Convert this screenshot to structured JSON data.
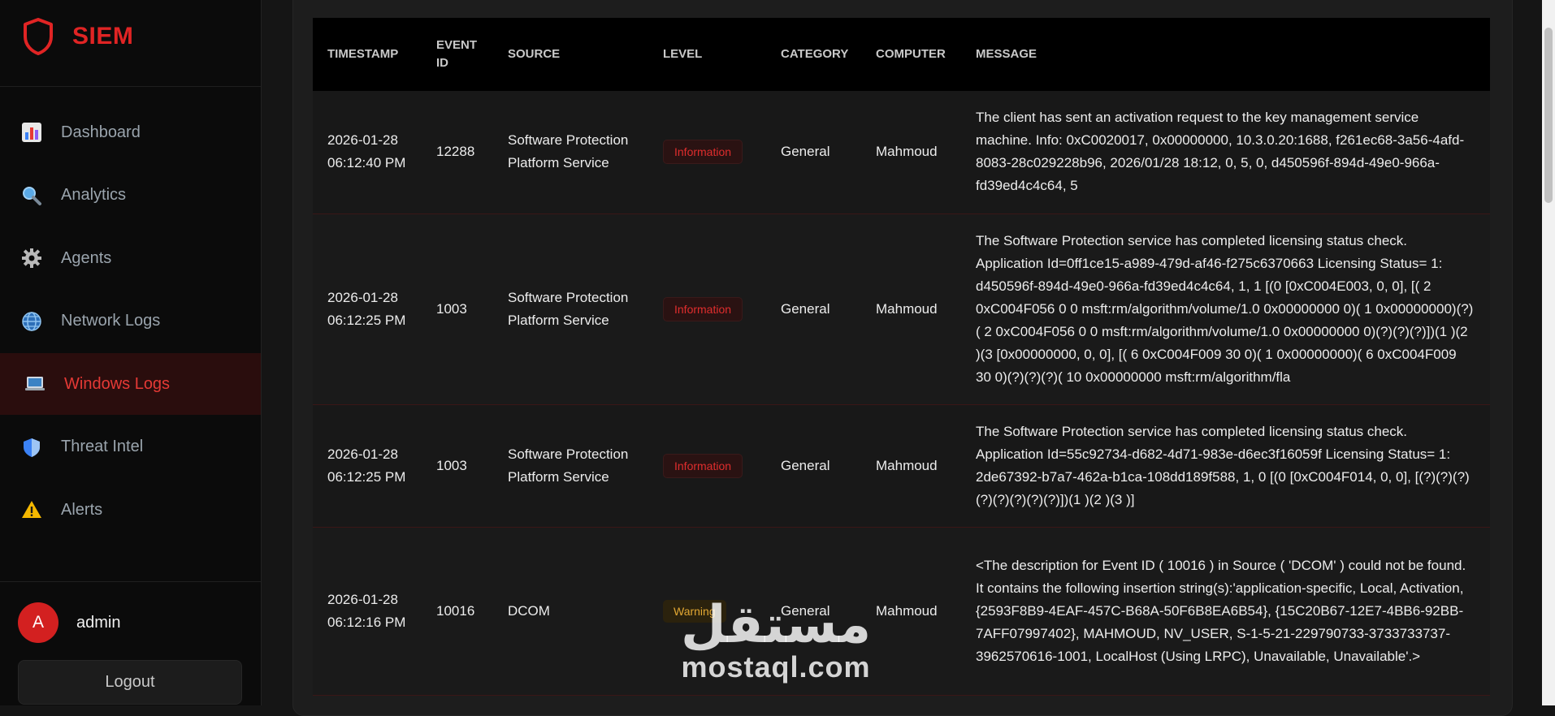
{
  "app": {
    "brand": "SIEM",
    "accent": "#e02424"
  },
  "sidebar": {
    "items": [
      {
        "label": "Dashboard",
        "icon": "bar-chart-icon"
      },
      {
        "label": "Analytics",
        "icon": "magnifier-icon"
      },
      {
        "label": "Agents",
        "icon": "gear-icon"
      },
      {
        "label": "Network Logs",
        "icon": "globe-icon"
      },
      {
        "label": "Windows Logs",
        "icon": "laptop-icon",
        "active": true
      },
      {
        "label": "Threat Intel",
        "icon": "shield-icon"
      },
      {
        "label": "Alerts",
        "icon": "warning-icon"
      }
    ],
    "user": {
      "initial": "A",
      "name": "admin"
    },
    "logout_label": "Logout"
  },
  "table": {
    "headers": [
      "TIMESTAMP",
      "EVENT ID",
      "SOURCE",
      "LEVEL",
      "CATEGORY",
      "COMPUTER",
      "MESSAGE"
    ],
    "rows": [
      {
        "timestamp": "2026-01-28 06:12:40 PM",
        "event_id": "12288",
        "source": "Software Protection Platform Service",
        "level": "Information",
        "category": "General",
        "computer": "Mahmoud",
        "message": "The client has sent an activation request to the key management service machine. Info: 0xC0020017, 0x00000000, 10.3.0.20:1688, f261ec68-3a56-4afd-8083-28c029228b96, 2026/01/28 18:12, 0, 5, 0, d450596f-894d-49e0-966a-fd39ed4c4c64, 5"
      },
      {
        "timestamp": "2026-01-28 06:12:25 PM",
        "event_id": "1003",
        "source": "Software Protection Platform Service",
        "level": "Information",
        "category": "General",
        "computer": "Mahmoud",
        "message": "The Software Protection service has completed licensing status check. Application Id=0ff1ce15-a989-479d-af46-f275c6370663 Licensing Status= 1: d450596f-894d-49e0-966a-fd39ed4c4c64, 1, 1 [(0 [0xC004E003, 0, 0], [( 2 0xC004F056 0 0 msft:rm/algorithm/volume/1.0 0x00000000 0)( 1 0x00000000)(?)( 2 0xC004F056 0 0 msft:rm/algorithm/volume/1.0 0x00000000 0)(?)(?)(?)])(1 )(2 )(3 [0x00000000, 0, 0], [( 6 0xC004F009 30 0)( 1 0x00000000)( 6 0xC004F009 30 0)(?)(?)(?)( 10 0x00000000 msft:rm/algorithm/fla"
      },
      {
        "timestamp": "2026-01-28 06:12:25 PM",
        "event_id": "1003",
        "source": "Software Protection Platform Service",
        "level": "Information",
        "category": "General",
        "computer": "Mahmoud",
        "message": "The Software Protection service has completed licensing status check. Application Id=55c92734-d682-4d71-983e-d6ec3f16059f Licensing Status= 1: 2de67392-b7a7-462a-b1ca-108dd189f588, 1, 0 [(0 [0xC004F014, 0, 0], [(?)(?)(?)(?)(?)(?)(?)(?)])(1 )(2 )(3 )]"
      },
      {
        "timestamp": "2026-01-28 06:12:16 PM",
        "event_id": "10016",
        "source": "DCOM",
        "level": "Warning",
        "category": "General",
        "computer": "Mahmoud",
        "message": "<The description for Event ID ( 10016 ) in Source ( 'DCOM' ) could not be found. It contains the following insertion string(s):'application-specific, Local, Activation, {2593F8B9-4EAF-457C-B68A-50F6B8EA6B54}, {15C20B67-12E7-4BB6-92BB-7AFF07997402}, MAHMOUD, NV_USER, S-1-5-21-229790733-3733733737-3962570616-1001, LocalHost (Using LRPC), Unavailable, Unavailable'.>"
      }
    ]
  },
  "watermark": {
    "arabic": "مستقل",
    "latin": "mostaql.com"
  }
}
